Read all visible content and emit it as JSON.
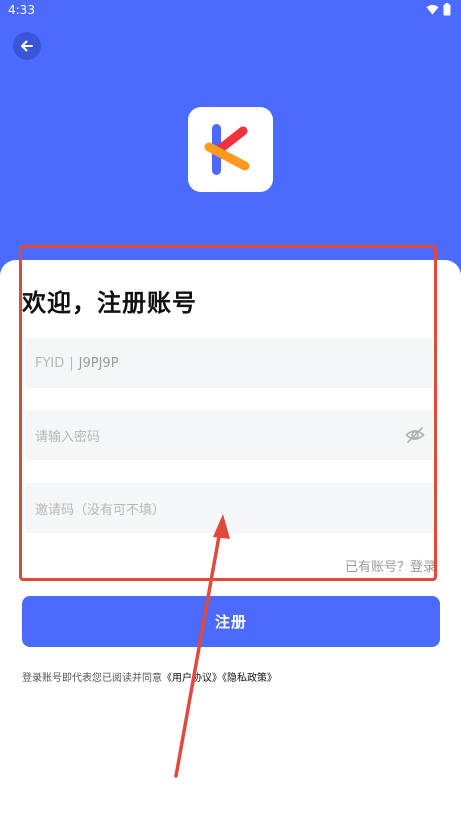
{
  "status_bar": {
    "time": "4:33",
    "icons": [
      "wifi-icon",
      "battery-icon"
    ]
  },
  "header": {
    "back_icon": "arrow-left-icon",
    "logo": "app-logo-k"
  },
  "form": {
    "title": "欢迎，注册账号",
    "fyid_label": "FYID",
    "fyid_separator": "|",
    "fyid_value": "J9PJ9P",
    "password_placeholder": "请输入密码",
    "invite_placeholder": "邀请码（没有可不填）",
    "has_account_text": "已有账号？登录"
  },
  "actions": {
    "register_label": "注册"
  },
  "footer": {
    "agreement_prefix": "登录账号即代表您已阅读并同意",
    "user_agreement": "《用户协议》",
    "privacy_policy": "《隐私政策》"
  },
  "colors": {
    "brand_blue": "#4a6bfb",
    "annotation_red": "#e04a3c"
  }
}
